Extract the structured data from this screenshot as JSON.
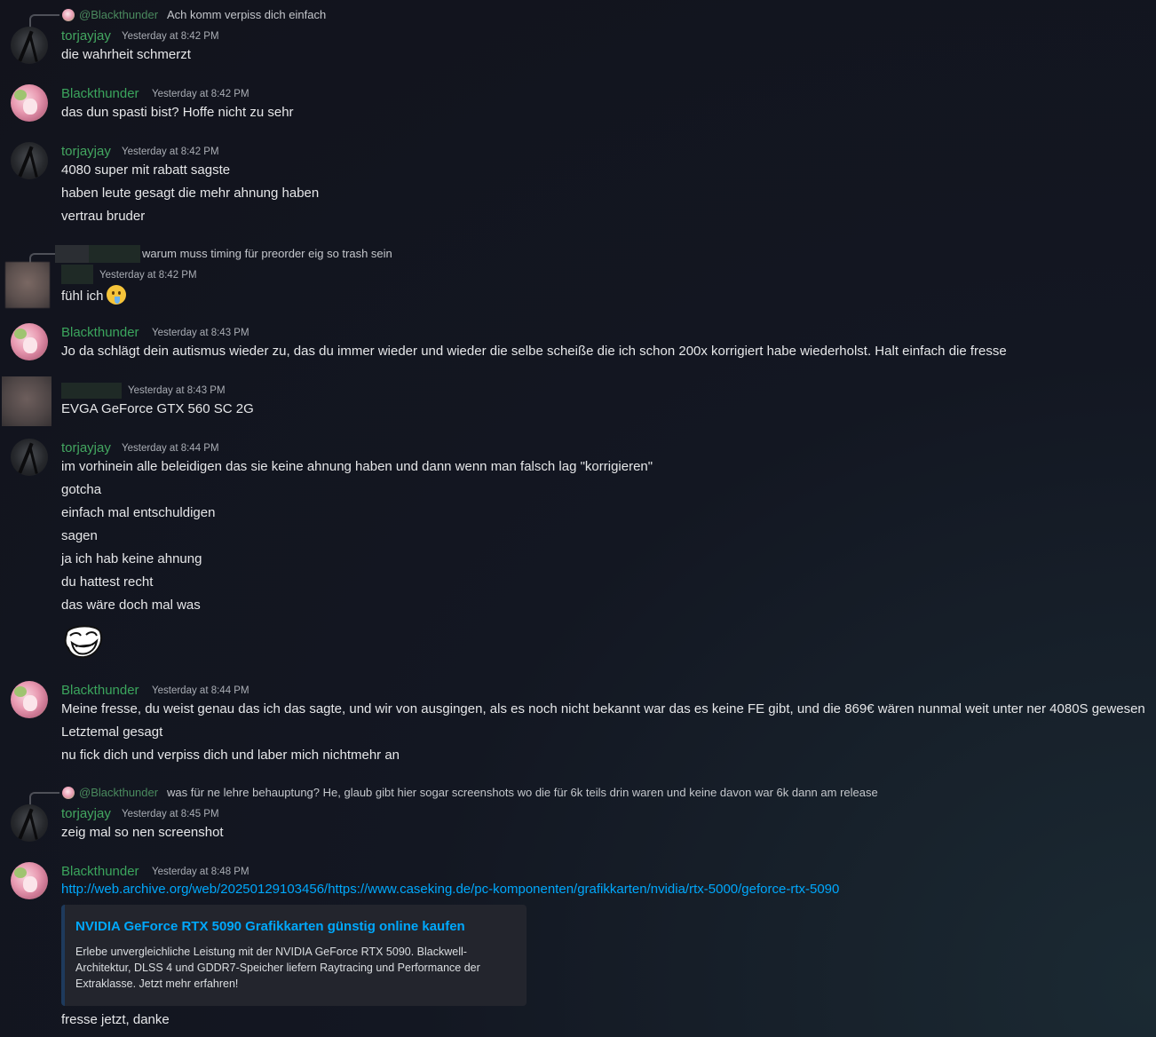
{
  "messages": [
    {
      "reply": {
        "mention": "@Blackthunder",
        "text": "Ach komm verpiss dich einfach"
      },
      "author": "torjayjay",
      "timestamp": "Yesterday at 8:42 PM",
      "lines": [
        "die wahrheit schmerzt"
      ]
    },
    {
      "author": "Blackthunder",
      "timestamp": "Yesterday at 8:42 PM",
      "lines": [
        "das dun spasti bist? Hoffe nicht zu sehr"
      ]
    },
    {
      "author": "torjayjay",
      "timestamp": "Yesterday at 8:42 PM",
      "lines": [
        "4080 super mit rabatt sagste",
        "haben leute gesagt die mehr ahnung haben",
        "vertrau bruder"
      ]
    },
    {
      "reply": {
        "text": "warum muss timing für preorder eig so trash sein"
      },
      "author_redacted": true,
      "timestamp": "Yesterday at 8:42 PM",
      "lines": [
        "fühl ich"
      ],
      "emoji": "drooling-face-emoji"
    },
    {
      "author": "Blackthunder",
      "timestamp": "Yesterday at 8:43 PM",
      "lines": [
        "Jo da schlägt dein autismus wieder zu, das du immer wieder und wieder die selbe scheiße die ich schon 200x korrigiert habe wiederholst. Halt einfach die fresse"
      ]
    },
    {
      "author_redacted": true,
      "timestamp": "Yesterday at 8:43 PM",
      "lines": [
        "EVGA GeForce GTX 560 SC 2G"
      ]
    },
    {
      "author": "torjayjay",
      "timestamp": "Yesterday at 8:44 PM",
      "lines": [
        "im vorhinein alle beleidigen das sie keine ahnung haben und dann wenn man falsch lag \"korrigieren\"",
        "gotcha",
        "einfach mal entschuldigen",
        "sagen",
        "ja ich hab keine ahnung",
        "du hattest recht",
        "das wäre doch mal was"
      ],
      "sticker": "troll-face-emoji"
    },
    {
      "author": "Blackthunder",
      "timestamp": "Yesterday at 8:44 PM",
      "lines": [
        "Meine fresse, du weist genau das ich das sagte, und wir von ausgingen, als es noch nicht bekannt war das es keine FE gibt, und die 869€ wären nunmal weit unter ner 4080S gewesen",
        "Letztemal gesagt",
        "nu fick dich und verpiss dich und laber mich nichtmehr an"
      ]
    },
    {
      "reply": {
        "mention": "@Blackthunder",
        "text": "was für ne lehre behauptung? He, glaub gibt hier sogar screenshots wo die für 6k teils drin waren und keine davon war 6k dann am release"
      },
      "author": "torjayjay",
      "timestamp": "Yesterday at 8:45 PM",
      "lines": [
        "zeig mal so nen screenshot"
      ]
    },
    {
      "author": "Blackthunder",
      "timestamp": "Yesterday at 8:48 PM",
      "link": "http://web.archive.org/web/20250129103456/https://www.caseking.de/pc-komponenten/grafikkarten/nvidia/rtx-5000/geforce-rtx-5090",
      "embed": {
        "title": "NVIDIA GeForce RTX 5090 Grafikkarten günstig online kaufen",
        "description": "Erlebe unvergleichliche Leistung mit der NVIDIA GeForce RTX 5090. Blackwell-Architektur, DLSS 4 und GDDR7-Speicher liefern Raytracing und Performance der Extraklasse. Jetzt mehr erfahren!"
      },
      "lines": [
        "fresse jetzt, danke"
      ]
    }
  ],
  "colors": {
    "username_green": "#3ba55d",
    "link_blue": "#00a8fc",
    "background": "#131722"
  }
}
